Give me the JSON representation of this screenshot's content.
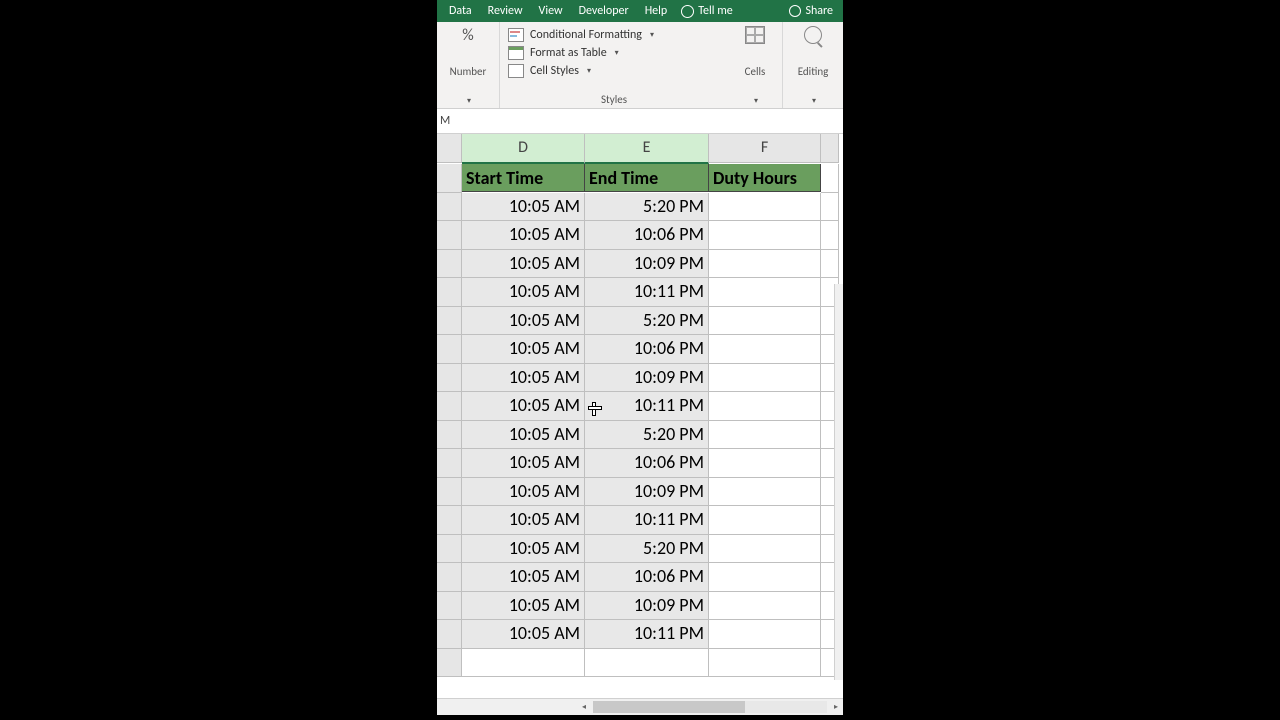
{
  "ribbon": {
    "tabs": [
      "Data",
      "Review",
      "View",
      "Developer",
      "Help"
    ],
    "tell_me": "Tell me",
    "share": "Share"
  },
  "groups": {
    "number": {
      "icon": "%",
      "label": "Number"
    },
    "styles": {
      "cf": "Conditional Formatting",
      "ft": "Format as Table",
      "cs": "Cell Styles",
      "label": "Styles"
    },
    "cells": {
      "label": "Cells"
    },
    "editing": {
      "label": "Editing"
    }
  },
  "formula_bar": "M",
  "columns": [
    "D",
    "E",
    "F"
  ],
  "headers": [
    "Start Time",
    "End Time",
    "Duty Hours"
  ],
  "chart_data": {
    "type": "table",
    "columns": [
      "Start Time",
      "End Time",
      "Duty Hours"
    ],
    "rows": [
      [
        "10:05 AM",
        "5:20 PM",
        ""
      ],
      [
        "10:05 AM",
        "10:06 PM",
        ""
      ],
      [
        "10:05 AM",
        "10:09 PM",
        ""
      ],
      [
        "10:05 AM",
        "10:11 PM",
        ""
      ],
      [
        "10:05 AM",
        "5:20 PM",
        ""
      ],
      [
        "10:05 AM",
        "10:06 PM",
        ""
      ],
      [
        "10:05 AM",
        "10:09 PM",
        ""
      ],
      [
        "10:05 AM",
        "10:11 PM",
        ""
      ],
      [
        "10:05 AM",
        "5:20 PM",
        ""
      ],
      [
        "10:05 AM",
        "10:06 PM",
        ""
      ],
      [
        "10:05 AM",
        "10:09 PM",
        ""
      ],
      [
        "10:05 AM",
        "10:11 PM",
        ""
      ],
      [
        "10:05 AM",
        "5:20 PM",
        ""
      ],
      [
        "10:05 AM",
        "10:06 PM",
        ""
      ],
      [
        "10:05 AM",
        "10:09 PM",
        ""
      ],
      [
        "10:05 AM",
        "10:11 PM",
        ""
      ]
    ]
  }
}
